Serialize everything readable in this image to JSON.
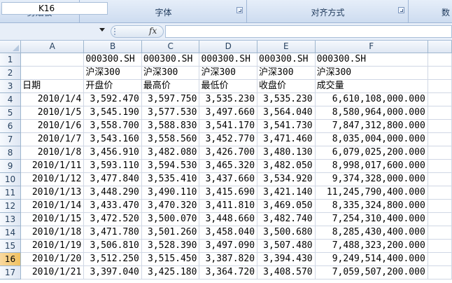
{
  "ribbon": {
    "groups": [
      {
        "label": "剪贴板"
      },
      {
        "label": "字体"
      },
      {
        "label": "对齐方式"
      },
      {
        "label": "数"
      }
    ]
  },
  "formula_bar": {
    "name_box": "K16",
    "fx_label": "fx",
    "content": ""
  },
  "columns": [
    "A",
    "B",
    "C",
    "D",
    "E",
    "F"
  ],
  "rows": [
    {
      "n": "1",
      "cells": [
        "",
        "000300.SH",
        "000300.SH",
        "000300.SH",
        "000300.SH",
        "000300.SH"
      ]
    },
    {
      "n": "2",
      "cells": [
        "",
        "沪深300",
        "沪深300",
        "沪深300",
        "沪深300",
        "沪深300"
      ]
    },
    {
      "n": "3",
      "cells": [
        "日期",
        "开盘价",
        "最高价",
        "最低价",
        "收盘价",
        "成交量"
      ]
    },
    {
      "n": "4",
      "cells": [
        "2010/1/4",
        "3,592.470",
        "3,597.750",
        "3,535.230",
        "3,535.230",
        "6,610,108,000.000"
      ]
    },
    {
      "n": "5",
      "cells": [
        "2010/1/5",
        "3,545.190",
        "3,577.530",
        "3,497.660",
        "3,564.040",
        "8,580,964,000.000"
      ]
    },
    {
      "n": "6",
      "cells": [
        "2010/1/6",
        "3,558.700",
        "3,588.830",
        "3,541.170",
        "3,541.730",
        "7,847,312,800.000"
      ]
    },
    {
      "n": "7",
      "cells": [
        "2010/1/7",
        "3,543.160",
        "3,558.560",
        "3,452.770",
        "3,471.460",
        "8,035,004,000.000"
      ]
    },
    {
      "n": "8",
      "cells": [
        "2010/1/8",
        "3,456.910",
        "3,482.080",
        "3,426.700",
        "3,480.130",
        "6,079,025,200.000"
      ]
    },
    {
      "n": "9",
      "cells": [
        "2010/1/11",
        "3,593.110",
        "3,594.530",
        "3,465.320",
        "3,482.050",
        "8,998,017,600.000"
      ]
    },
    {
      "n": "10",
      "cells": [
        "2010/1/12",
        "3,477.840",
        "3,535.410",
        "3,437.660",
        "3,534.920",
        "9,374,328,000.000"
      ]
    },
    {
      "n": "11",
      "cells": [
        "2010/1/13",
        "3,448.290",
        "3,490.110",
        "3,415.690",
        "3,421.140",
        "11,245,790,400.000"
      ]
    },
    {
      "n": "12",
      "cells": [
        "2010/1/14",
        "3,433.470",
        "3,470.320",
        "3,411.810",
        "3,469.050",
        "8,335,324,800.000"
      ]
    },
    {
      "n": "13",
      "cells": [
        "2010/1/15",
        "3,472.520",
        "3,500.070",
        "3,448.660",
        "3,482.740",
        "7,254,310,400.000"
      ]
    },
    {
      "n": "14",
      "cells": [
        "2010/1/18",
        "3,471.780",
        "3,501.260",
        "3,458.040",
        "3,500.680",
        "8,285,430,400.000"
      ]
    },
    {
      "n": "15",
      "cells": [
        "2010/1/19",
        "3,506.810",
        "3,528.390",
        "3,497.090",
        "3,507.480",
        "7,488,323,200.000"
      ]
    },
    {
      "n": "16",
      "cells": [
        "2010/1/20",
        "3,512.250",
        "3,515.450",
        "3,387.820",
        "3,394.430",
        "9,249,514,400.000"
      ]
    },
    {
      "n": "17",
      "cells": [
        "2010/1/21",
        "3,397.040",
        "3,425.180",
        "3,364.720",
        "3,408.570",
        "7,059,507,200.000"
      ]
    }
  ],
  "selected_row": "16"
}
